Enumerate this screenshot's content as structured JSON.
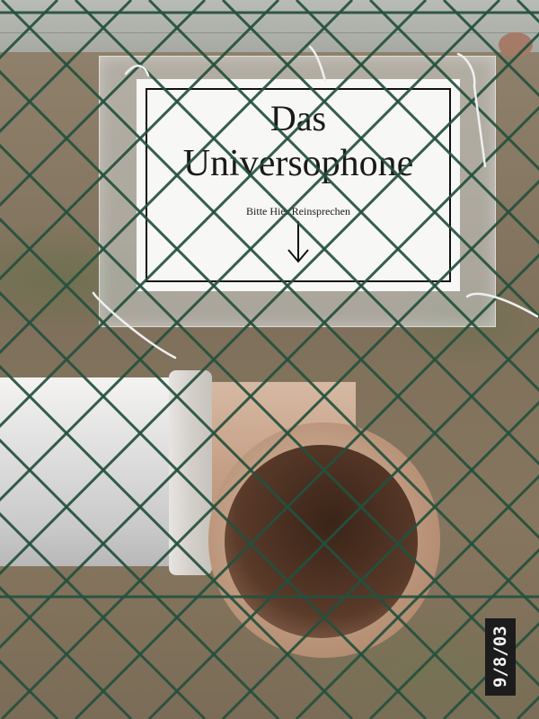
{
  "sign": {
    "line1": "Das",
    "line2": "Universophone",
    "line3": "Bitte Hier Reinsprechen",
    "arrow_icon": "down-arrow-icon"
  },
  "photo": {
    "date_stamp": "9/8/03"
  },
  "colors": {
    "fence_wire": "#24503d",
    "sign_paper": "#f7f7f5",
    "pipe_tan": "#c59f85",
    "pipe_white": "#e6e5e3",
    "date_stamp_bg": "#1c1c1c"
  }
}
